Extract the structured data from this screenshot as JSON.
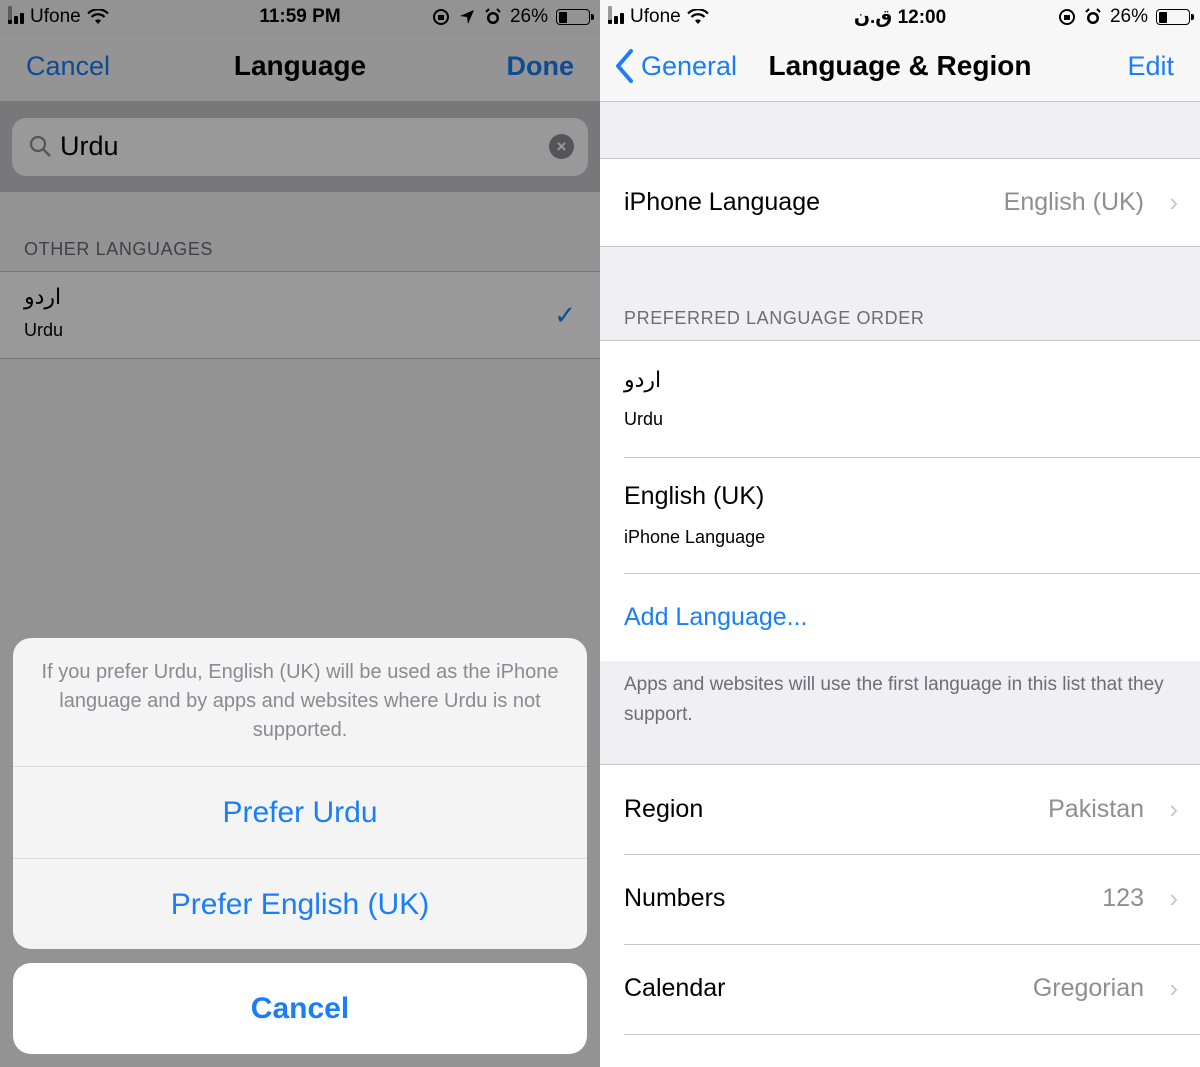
{
  "left": {
    "status": {
      "carrier": "Ufone",
      "time": "11:59 PM",
      "battery": "26%",
      "battery_level": 0.26
    },
    "nav": {
      "title": "Language",
      "cancel_label": "Cancel",
      "done_label": "Done"
    },
    "search": {
      "value": "Urdu"
    },
    "section_header": "OTHER LANGUAGES",
    "result": {
      "native": "اردو",
      "english": "Urdu"
    },
    "action_sheet": {
      "message": "If you prefer Urdu, English (UK) will be used as the iPhone language and by apps and websites where Urdu is not supported.",
      "option_1": "Prefer Urdu",
      "option_2": "Prefer English (UK)",
      "cancel": "Cancel"
    }
  },
  "right": {
    "status": {
      "carrier": "Ufone",
      "time": "12:00 ق.ن",
      "battery": "26%",
      "battery_level": 0.26
    },
    "nav": {
      "back_label": "General",
      "title": "Language & Region",
      "edit_label": "Edit"
    },
    "iphone_language": {
      "label": "iPhone Language",
      "value": "English (UK)"
    },
    "preferred_header": "PREFERRED LANGUAGE ORDER",
    "languages": [
      {
        "primary": "اردو",
        "secondary": "Urdu"
      },
      {
        "primary": "English (UK)",
        "secondary": "iPhone Language"
      }
    ],
    "add_language": "Add Language...",
    "footer": "Apps and websites will use the first language in this list that they support.",
    "settings": [
      {
        "label": "Region",
        "value": "Pakistan"
      },
      {
        "label": "Numbers",
        "value": "123"
      },
      {
        "label": "Calendar",
        "value": "Gregorian"
      }
    ]
  },
  "colors": {
    "accent": "#1a7ef6",
    "secondary_text": "#8e8e93",
    "grouped_bg": "#efeff4"
  }
}
